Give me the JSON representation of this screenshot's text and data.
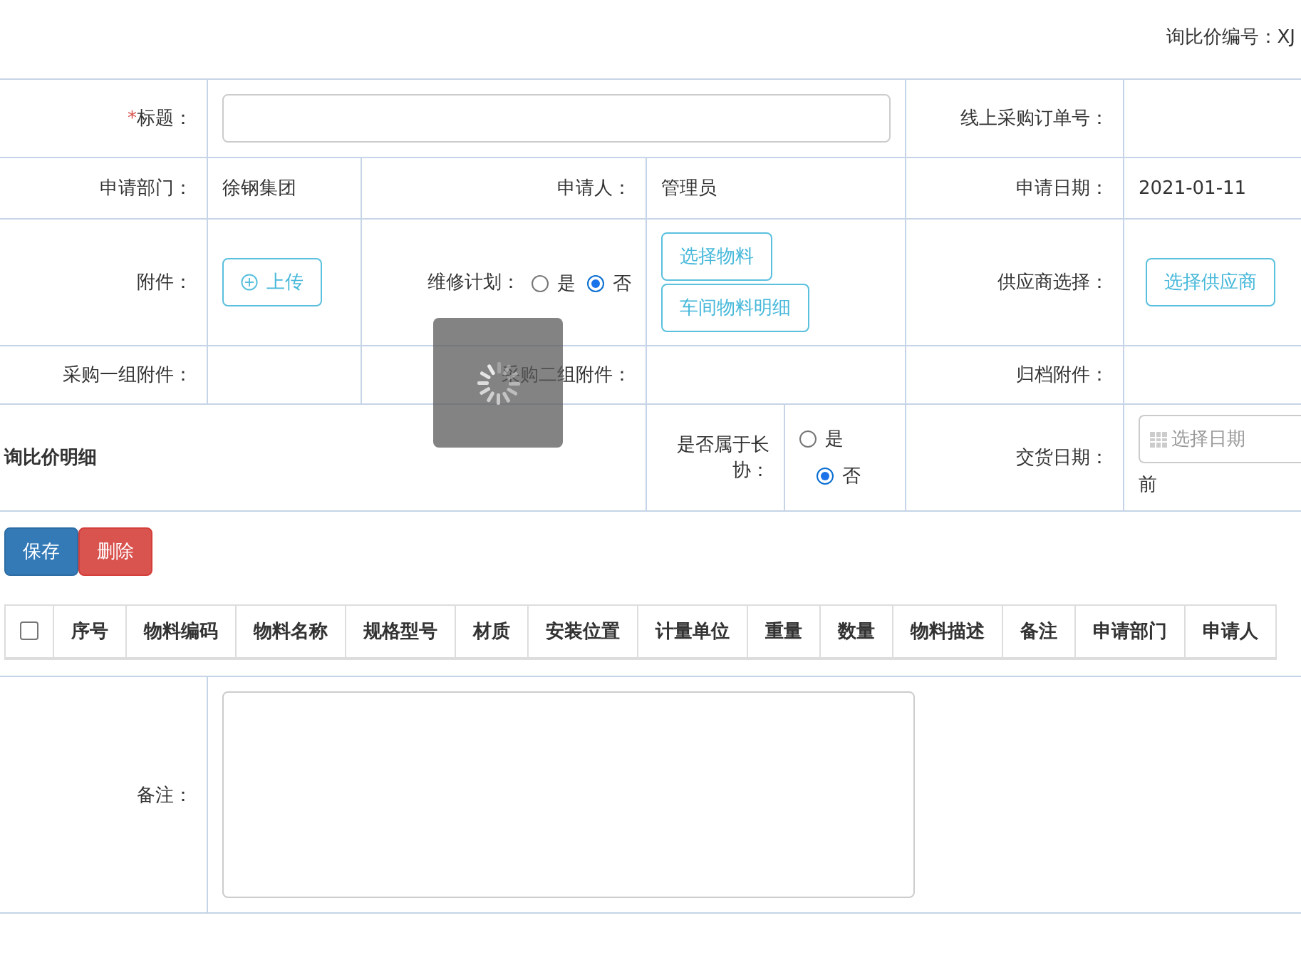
{
  "inquiry_number": {
    "label": "询比价编号：",
    "value": "XJ"
  },
  "form": {
    "title": {
      "required_mark": "*",
      "label": "标题："
    },
    "online_po": {
      "label": "线上采购订单号："
    },
    "department": {
      "label": "申请部门：",
      "value": "徐钢集团"
    },
    "applicant": {
      "label": "申请人：",
      "value": "管理员"
    },
    "apply_date": {
      "label": "申请日期：",
      "value": "2021-01-11"
    },
    "attachment": {
      "label": "附件：",
      "button": "上传"
    },
    "repair_plan": {
      "label": "维修计划：",
      "options": [
        {
          "label": "是",
          "selected": false
        },
        {
          "label": "否",
          "selected": true
        }
      ]
    },
    "material_buttons": [
      "选择物料",
      "车间物料明细"
    ],
    "supplier": {
      "label": "供应商选择：",
      "button": "选择供应商"
    },
    "group1_attachment": {
      "label": "采购一组附件："
    },
    "group2_attachment": {
      "label": "采购二组附件："
    },
    "archive_attachment": {
      "label": "归档附件："
    },
    "detail_title": "询比价明细",
    "long_term": {
      "label": "是否属于长协：",
      "options": [
        {
          "label": "是",
          "selected": false
        },
        {
          "label": "否",
          "selected": true
        }
      ]
    },
    "delivery_date": {
      "label": "交货日期：",
      "placeholder": "选择日期",
      "suffix": "前"
    }
  },
  "actions": [
    {
      "label": "保存",
      "kind": "primary"
    },
    {
      "label": "删除",
      "kind": "danger"
    }
  ],
  "table": {
    "select_all": {
      "checked": false
    },
    "columns": [
      "序号",
      "物料编码",
      "物料名称",
      "规格型号",
      "材质",
      "安装位置",
      "计量单位",
      "重量",
      "数量",
      "物料描述",
      "备注",
      "申请部门",
      "申请人"
    ]
  },
  "remarks": {
    "label": "备注："
  },
  "loading": true
}
